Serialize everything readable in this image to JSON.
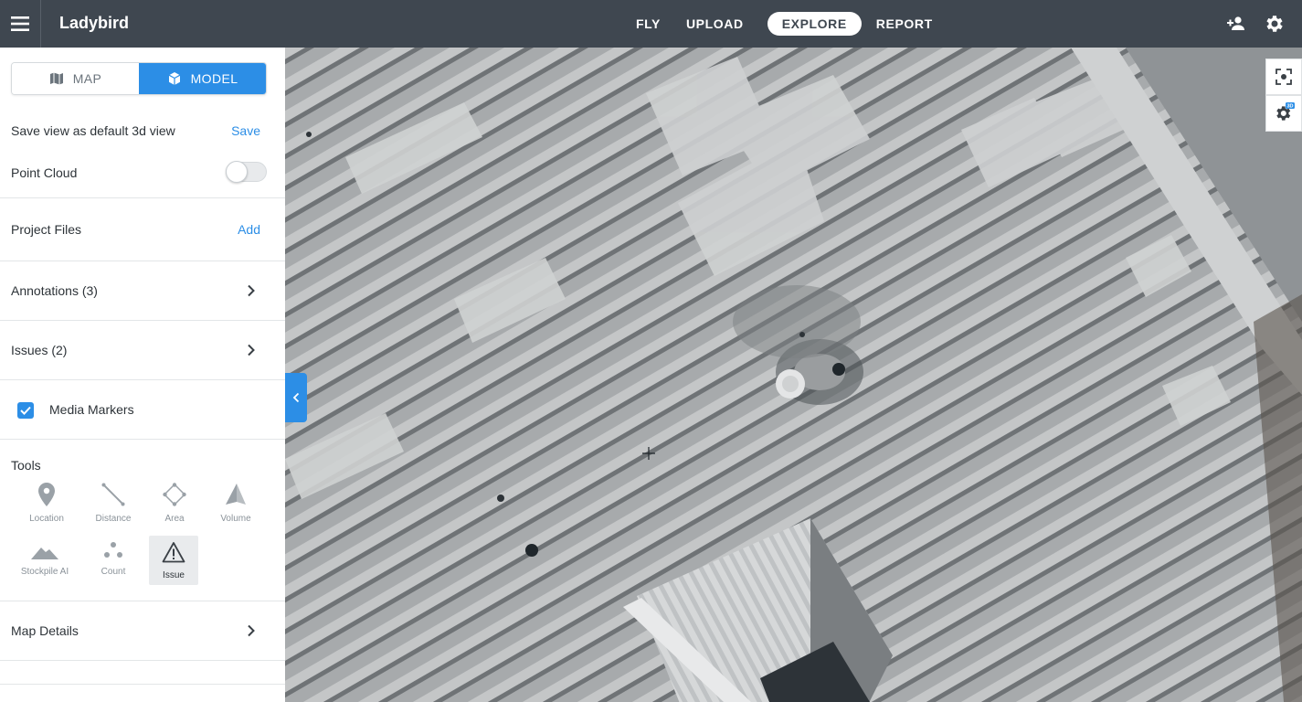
{
  "app": {
    "title": "Ladybird"
  },
  "nav": {
    "items": [
      {
        "label": "FLY"
      },
      {
        "label": "UPLOAD"
      },
      {
        "label": "EXPLORE"
      },
      {
        "label": "REPORT"
      }
    ]
  },
  "header_icons": {
    "people": "people-add-icon",
    "settings": "gear-icon"
  },
  "sidebar": {
    "view_toggle": {
      "map_label": "MAP",
      "model_label": "MODEL",
      "selected": "MODEL"
    },
    "save_view": {
      "label": "Save view as default 3d view",
      "action": "Save"
    },
    "point_cloud": {
      "label": "Point Cloud",
      "enabled": false
    },
    "project_files": {
      "label": "Project Files",
      "action": "Add"
    },
    "annotations": {
      "label": "Annotations (3)"
    },
    "issues": {
      "label": "Issues (2)"
    },
    "media_markers": {
      "label": "Media Markers",
      "checked": true
    },
    "tools": {
      "title": "Tools",
      "items": [
        {
          "label": "Location",
          "icon": "location-pin-icon"
        },
        {
          "label": "Distance",
          "icon": "ruler-line-icon"
        },
        {
          "label": "Area",
          "icon": "polygon-area-icon"
        },
        {
          "label": "Volume",
          "icon": "volume-cone-icon"
        },
        {
          "label": "Stockpile AI",
          "icon": "mountain-icon"
        },
        {
          "label": "Count",
          "icon": "dots-count-icon"
        },
        {
          "label": "Issue",
          "icon": "warning-triangle-icon",
          "active": true
        }
      ]
    },
    "map_details": {
      "label": "Map Details"
    }
  },
  "map_controls": {
    "fit": "fit-to-screen-icon",
    "settings_3d": "3d-settings-icon",
    "badge": "3D"
  },
  "colors": {
    "topbar": "#3f4750",
    "accent": "#2c8ee6",
    "text": "#2d3338"
  }
}
